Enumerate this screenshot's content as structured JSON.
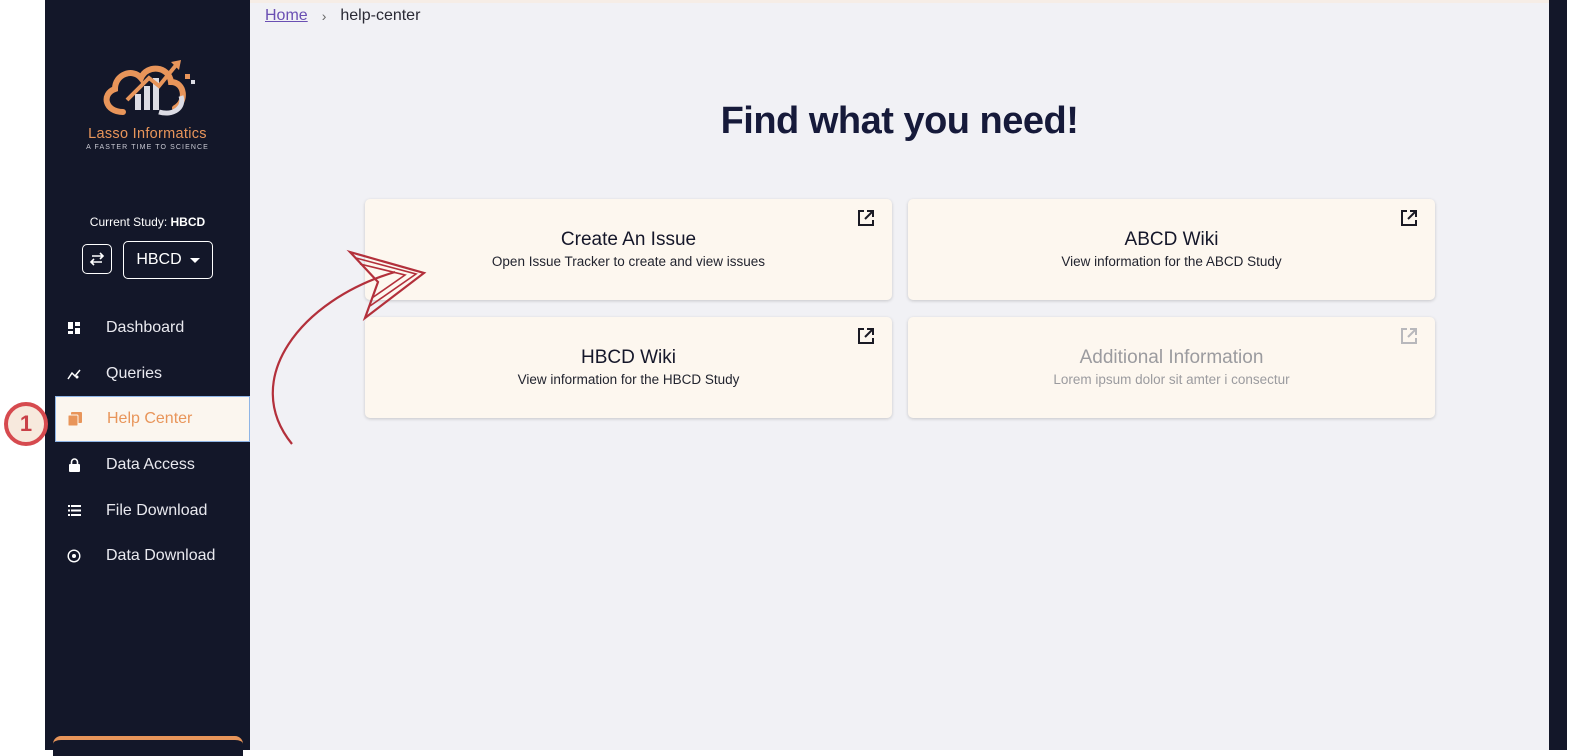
{
  "brand": {
    "name": "Lasso Informatics",
    "tagline": "A FASTER TIME TO SCIENCE"
  },
  "study": {
    "label": "Current Study:",
    "value": "HBCD",
    "selected": "HBCD"
  },
  "nav": {
    "items": [
      {
        "label": "Dashboard",
        "icon": "dashboard-icon"
      },
      {
        "label": "Queries",
        "icon": "query-chart-icon"
      },
      {
        "label": "Help Center",
        "icon": "help-book-icon"
      },
      {
        "label": "Data Access",
        "icon": "lock-icon"
      },
      {
        "label": "File Download",
        "icon": "list-icon"
      },
      {
        "label": "Data Download",
        "icon": "circle-download-icon"
      }
    ],
    "active_index": 2
  },
  "breadcrumb": {
    "home": "Home",
    "current": "help-center"
  },
  "page": {
    "title": "Find what you need!"
  },
  "cards": [
    {
      "title": "Create An Issue",
      "desc": "Open Issue Tracker to create and view issues",
      "enabled": true
    },
    {
      "title": "ABCD Wiki",
      "desc": "View information for the ABCD Study",
      "enabled": true
    },
    {
      "title": "HBCD Wiki",
      "desc": "View information for the HBCD Study",
      "enabled": true
    },
    {
      "title": "Additional Information",
      "desc": "Lorem ipsum dolor sit amter i consectur",
      "enabled": false
    }
  ],
  "annotation": {
    "step": "1"
  },
  "colors": {
    "sidebar": "#131729",
    "accent": "#e8955a",
    "card_bg": "#fdf7ef",
    "annotation": "#c0343f"
  }
}
